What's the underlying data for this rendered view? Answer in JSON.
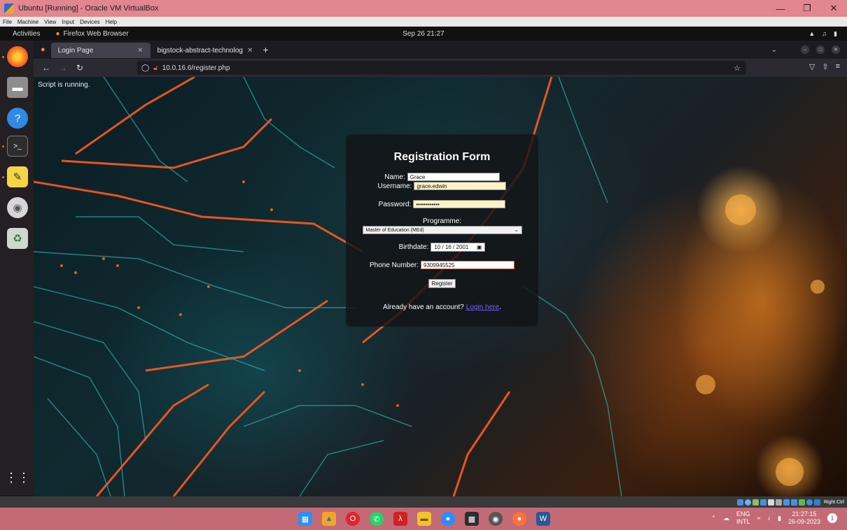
{
  "vbox": {
    "title": "Ubuntu [Running] - Oracle VM VirtualBox",
    "menu": [
      "File",
      "Machine",
      "View",
      "Input",
      "Devices",
      "Help"
    ],
    "status_label": "Right Ctrl"
  },
  "gnome": {
    "activities": "Activities",
    "app_name": "Firefox Web Browser",
    "clock": "Sep 26  21:27"
  },
  "firefox": {
    "tabs": [
      {
        "label": "Login Page",
        "active": true
      },
      {
        "label": "bigstock-abstract-technolog",
        "active": false
      }
    ],
    "url": "10.0.16.6/register.php"
  },
  "page": {
    "script_notice": "Script is running.",
    "form": {
      "title": "Registration Form",
      "name_label": "Name:",
      "name_value": "Grace",
      "username_label": "Username:",
      "username_value": "grace.edwin",
      "password_label": "Password:",
      "password_value": "••••••••••••",
      "programme_label": "Programme:",
      "programme_value": "Master of Education (MEd)",
      "birthdate_label": "Birthdate:",
      "birthdate_value": "10 / 16 / 2001",
      "phone_label": "Phone Number:",
      "phone_value": "9309945525",
      "register_label": "Register",
      "account_text": "Already have an account?",
      "login_link": "Login here",
      "period": "."
    }
  },
  "taskbar": {
    "lang_top": "ENG",
    "lang_bottom": "INTL",
    "time": "21:27:15",
    "date": "26-09-2023",
    "notification_count": "1"
  }
}
